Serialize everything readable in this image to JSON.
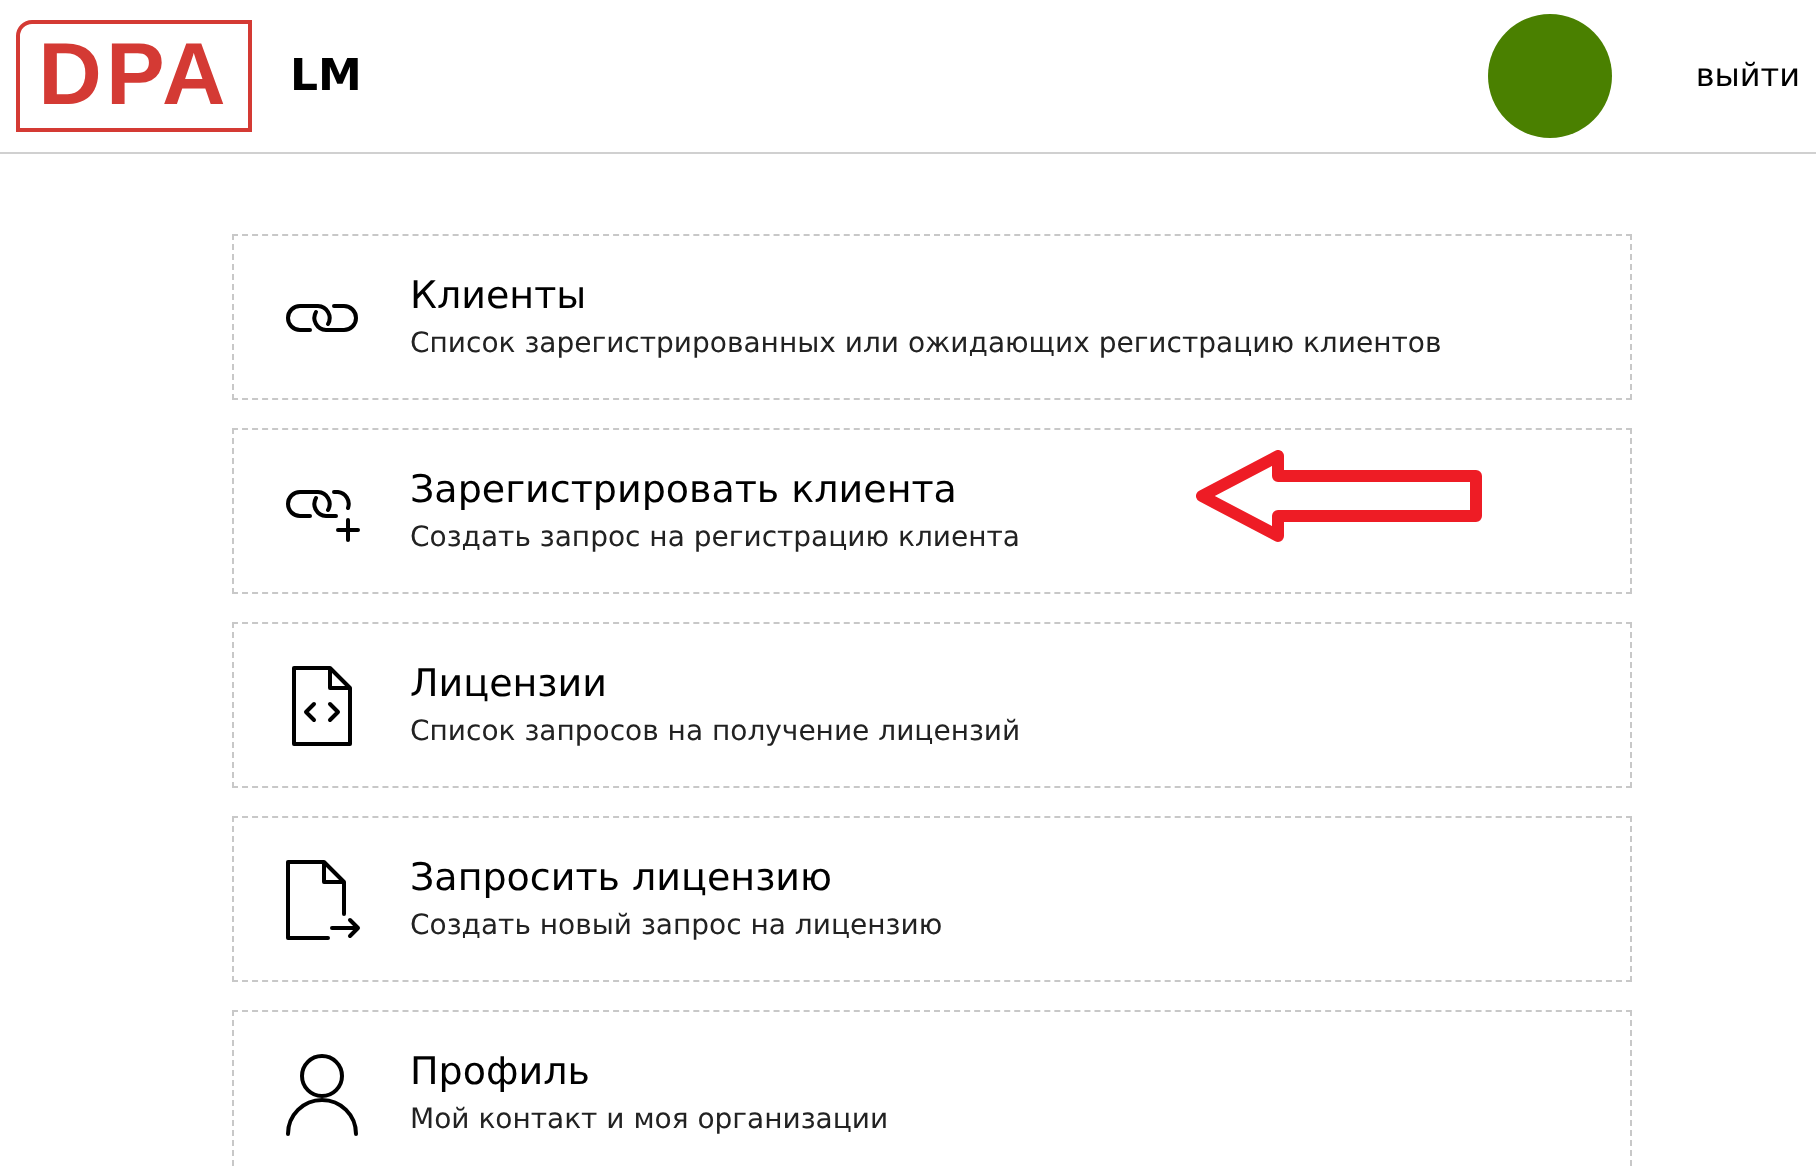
{
  "header": {
    "logo": "DPA",
    "app_name": "LM",
    "logout": "выйти"
  },
  "menu": [
    {
      "title": "Клиенты",
      "subtitle": "Список зарегистрированных или ожидающих регистрацию клиентов",
      "highlighted": false
    },
    {
      "title": "Зарегистрировать клиента",
      "subtitle": "Создать запрос на регистрацию клиента",
      "highlighted": true
    },
    {
      "title": "Лицензии",
      "subtitle": "Список запросов на получение лицензий",
      "highlighted": false
    },
    {
      "title": "Запросить лицензию",
      "subtitle": "Создать новый запрос на лицензию",
      "highlighted": false
    },
    {
      "title": "Профиль",
      "subtitle": "Мой контакт и моя организации",
      "highlighted": false
    }
  ]
}
